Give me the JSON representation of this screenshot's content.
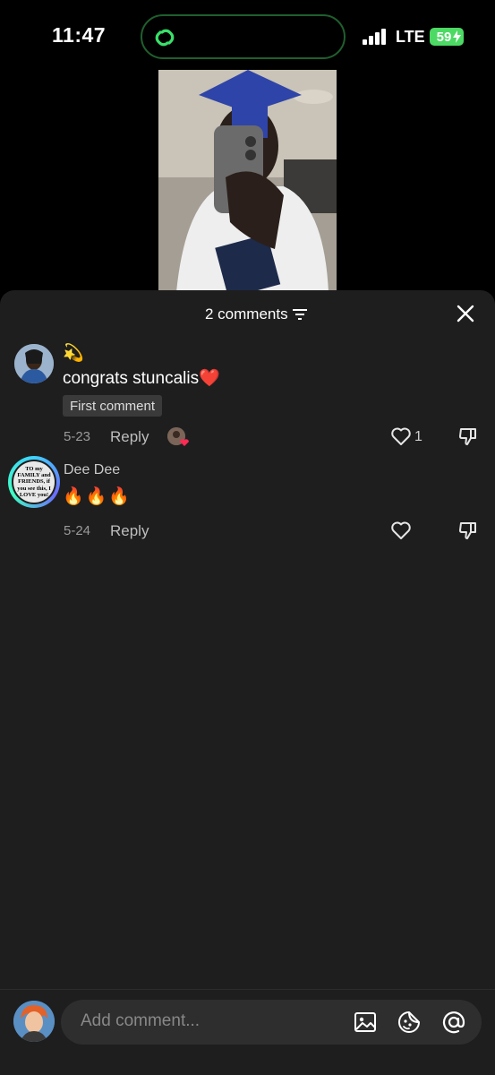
{
  "status_bar": {
    "time": "11:47",
    "network": "LTE",
    "battery": "59",
    "icons": [
      "link-icon",
      "signal-icon",
      "battery-charging-icon"
    ]
  },
  "panel": {
    "comment_count_label": "2 comments",
    "icons": [
      "sort-icon",
      "close-icon"
    ]
  },
  "comments": [
    {
      "username_emoji": "💫",
      "text": "congrats stuncalis",
      "text_emoji": "❤️",
      "badge": "First comment",
      "date": "5-23",
      "reply_label": "Reply",
      "likes": "1"
    },
    {
      "username": "Dee Dee",
      "text": "🔥🔥🔥",
      "avatar_text": "TO my FAMILY and FRIENDS, if you see this, I LOVE you!",
      "date": "5-24",
      "reply_label": "Reply"
    }
  ],
  "input": {
    "placeholder": "Add comment...",
    "icons": [
      "image-icon",
      "sticker-icon",
      "mention-icon"
    ]
  },
  "colors": {
    "panel_bg": "#1e1e1e",
    "accent_green": "#4cd964",
    "like_heart": "#ff2b54"
  }
}
